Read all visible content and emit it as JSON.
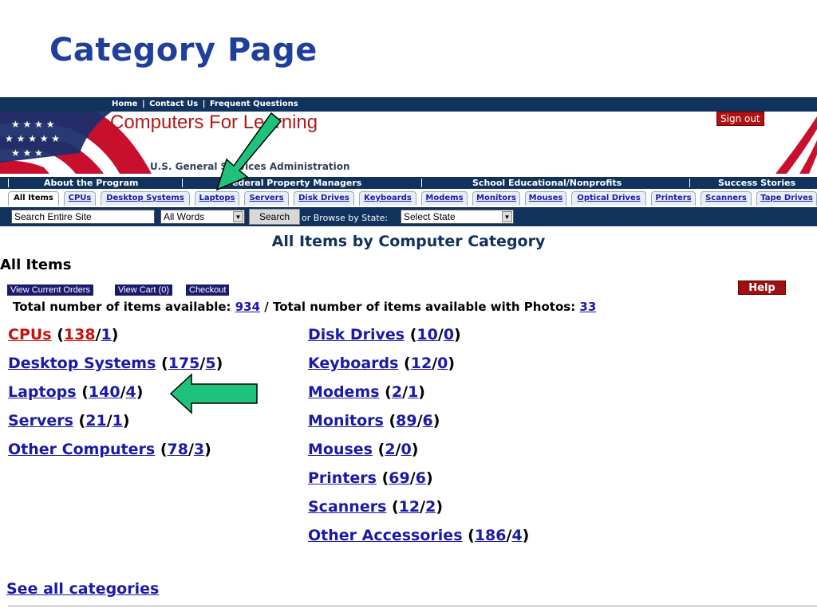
{
  "slide": {
    "title": "Category Page"
  },
  "header": {
    "top_links": [
      "Home",
      "|",
      "Contact Us",
      "|",
      "Frequent Questions"
    ],
    "site_title": "Computers For Learning",
    "agency": "U.S. General Services Administration",
    "sign_out": "Sign out"
  },
  "sections": [
    "About the Program",
    "Federal Property Managers",
    "School Educational/Nonprofits",
    "Success Stories"
  ],
  "tabs": [
    "All Items",
    "CPUs",
    "Desktop Systems",
    "Laptops",
    "Servers",
    "Disk Drives",
    "Keyboards",
    "Modems",
    "Monitors",
    "Mouses",
    "Optical Drives",
    "Printers",
    "Scanners",
    "Tape Drives"
  ],
  "search": {
    "input_value": "Search Entire Site",
    "mode": "All Words",
    "button": "Search",
    "browse_label": "or Browse by State:",
    "state": "Select State"
  },
  "main": {
    "heading": "All Items by Computer Category",
    "section": "All Items",
    "buttons": [
      "View Current Orders",
      "View Cart (0)",
      "Checkout"
    ],
    "help": "Help",
    "totals_label": "Total number of items available:",
    "totals_value": "934",
    "totals_sep": "/ Total number of items available with Photos:",
    "photos_value": "33"
  },
  "categories_left": [
    {
      "name": "CPUs",
      "count": "138",
      "photos": "1"
    },
    {
      "name": "Desktop Systems",
      "count": "175",
      "photos": "5"
    },
    {
      "name": "Laptops",
      "count": "140",
      "photos": "4"
    },
    {
      "name": "Servers",
      "count": "21",
      "photos": "1"
    },
    {
      "name": "Other Computers",
      "count": "78",
      "photos": "3"
    }
  ],
  "categories_right": [
    {
      "name": "Disk Drives",
      "count": "10",
      "photos": "0"
    },
    {
      "name": "Keyboards",
      "count": "12",
      "photos": "0"
    },
    {
      "name": "Modems",
      "count": "2",
      "photos": "1"
    },
    {
      "name": "Monitors",
      "count": "89",
      "photos": "6"
    },
    {
      "name": "Mouses",
      "count": "2",
      "photos": "0"
    },
    {
      "name": "Printers",
      "count": "69",
      "photos": "6"
    },
    {
      "name": "Scanners",
      "count": "12",
      "photos": "2"
    },
    {
      "name": "Other Accessories",
      "count": "186",
      "photos": "4"
    }
  ],
  "footer": {
    "see_all": "See all categories"
  },
  "colors": {
    "navy": "#10325c",
    "title_blue": "#1f3f9a",
    "link": "#1a1aa6",
    "red": "#c81010",
    "arrow": "#1fc27a"
  }
}
